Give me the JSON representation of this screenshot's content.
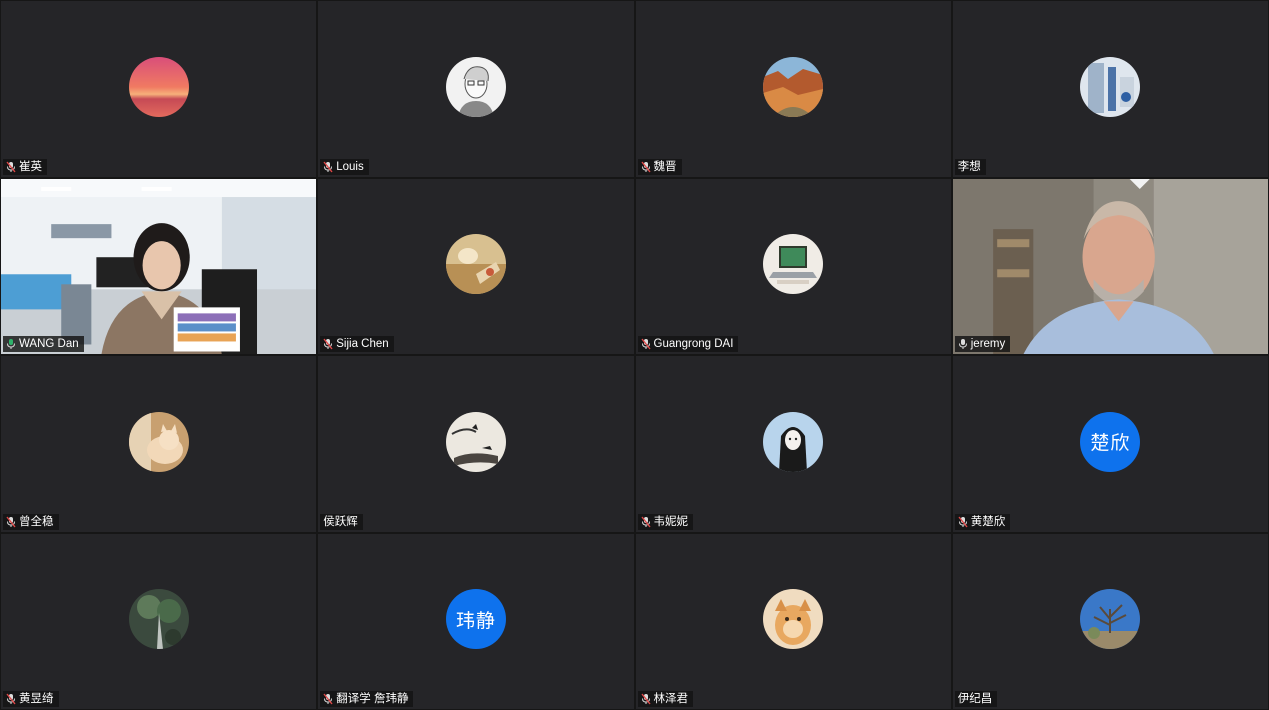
{
  "participants": [
    {
      "name": "崔英",
      "avatar": "sunset-avatar",
      "muted": true
    },
    {
      "name": "Louis",
      "avatar": "sketch-portrait-avatar",
      "muted": true
    },
    {
      "name": "魏晋",
      "avatar": "canyon-avatar",
      "muted": true
    },
    {
      "name": "李想",
      "avatar": "room-photo-avatar",
      "muted": false
    },
    {
      "name": "WANG Dan",
      "video": "office-video",
      "speaking": true,
      "muted": false
    },
    {
      "name": "Sijia Chen",
      "avatar": "table-photo-avatar",
      "muted": true
    },
    {
      "name": "Guangrong DAI",
      "avatar": "laptop-avatar",
      "muted": true
    },
    {
      "name": "jeremy",
      "video": "home-video",
      "muted": false
    },
    {
      "name": "曾全稳",
      "avatar": "cat-avatar",
      "muted": true
    },
    {
      "name": "侯跃辉",
      "avatar": "ink-painting-avatar",
      "muted": false
    },
    {
      "name": "韦妮妮",
      "avatar": "anime-girl-avatar",
      "muted": true
    },
    {
      "name": "黄楚欣",
      "initials": "楚欣",
      "muted": true
    },
    {
      "name": "黄昱绮",
      "avatar": "tree-avatar",
      "muted": true
    },
    {
      "name": "翻译学 詹玮静",
      "initials": "玮静",
      "muted": true
    },
    {
      "name": "林泽君",
      "avatar": "dog-avatar",
      "muted": true
    },
    {
      "name": "伊纪昌",
      "avatar": "sky-tree-avatar",
      "muted": false
    }
  ],
  "colors": {
    "tile_bg": "#252528",
    "speaking_border": "#2fb36b",
    "initials_bg": "#0e72ed",
    "muted_mic": "#e04848"
  }
}
